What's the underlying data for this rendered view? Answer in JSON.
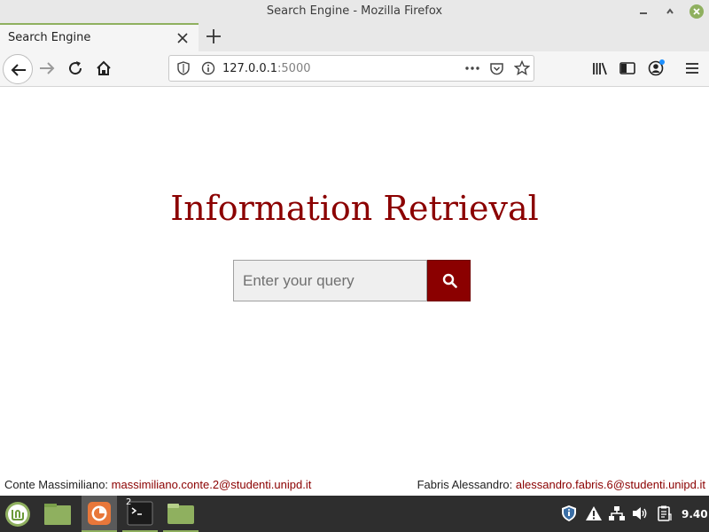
{
  "window": {
    "title": "Search Engine - Mozilla Firefox"
  },
  "tabs": [
    {
      "label": "Search Engine"
    }
  ],
  "urlbar": {
    "host": "127.0.0.1",
    "port": ":5000"
  },
  "page": {
    "heading": "Information Retrieval",
    "search": {
      "placeholder": "Enter your query",
      "value": ""
    },
    "footer": {
      "left_name": "Conte Massimiliano:",
      "left_email": "massimiliano.conte.2@studenti.unipd.it",
      "right_name": "Fabris Alessandro:",
      "right_email": "alessandro.fabris.6@studenti.unipd.it"
    }
  },
  "colors": {
    "accent": "#8b0000",
    "tab_accent": "#8fb05f",
    "taskbar": "#2e2e2e"
  },
  "taskbar": {
    "items": [
      {
        "icon": "mint-menu-icon"
      },
      {
        "icon": "show-desktop-folder-icon"
      },
      {
        "icon": "firefox-icon"
      },
      {
        "icon": "terminal-icon",
        "badge": "2"
      },
      {
        "icon": "files-folder-icon"
      }
    ],
    "tray": [
      "shield-icon",
      "warning-icon",
      "network-icon",
      "volume-icon",
      "clipboard-icon"
    ],
    "clock": "9.40"
  }
}
